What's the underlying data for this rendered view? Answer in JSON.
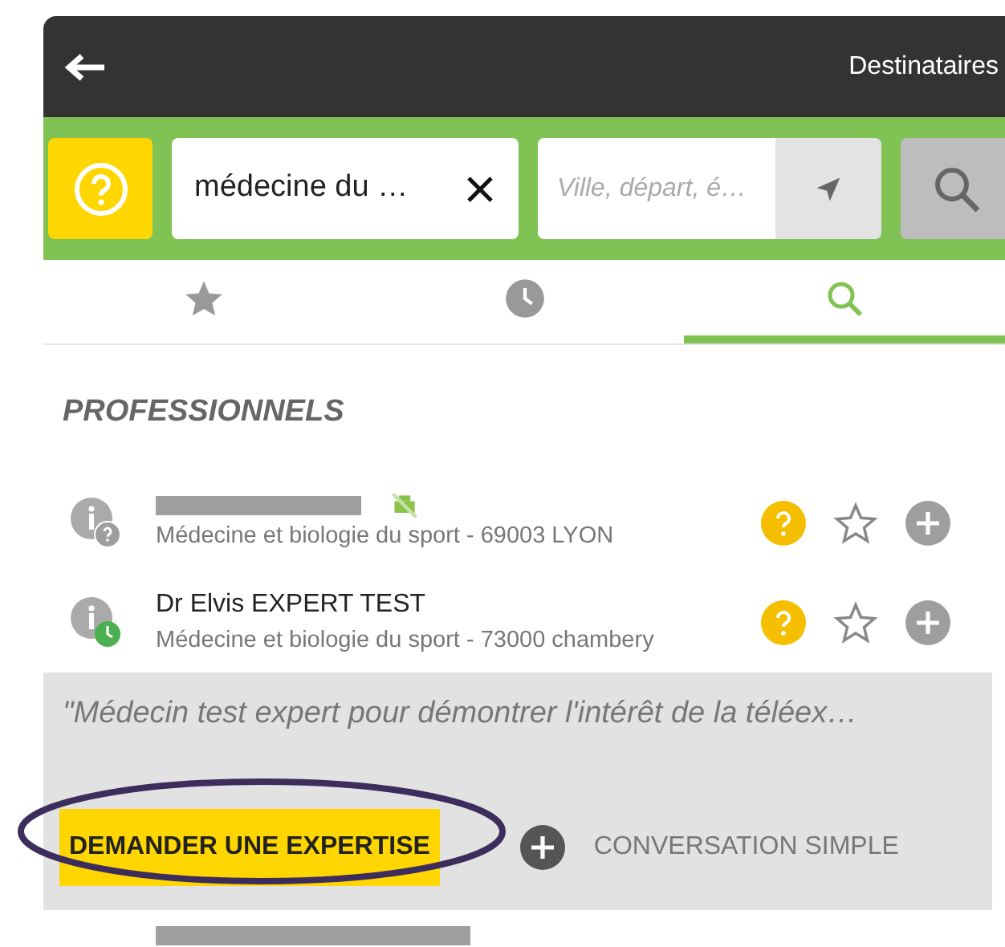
{
  "header": {
    "title": "Destinataires"
  },
  "search": {
    "query": "médecine du …",
    "location_placeholder": "Ville, départ, é…"
  },
  "tabs": [
    {
      "kind": "favorites",
      "selected": false
    },
    {
      "kind": "recent",
      "selected": false
    },
    {
      "kind": "search",
      "selected": true
    }
  ],
  "section_title": "PROFESSIONNELS",
  "professionals": [
    {
      "redacted": true,
      "kind": "unknown",
      "fax_disabled": true,
      "specialty": "Médecine et biologie du sport - 69003 LYON"
    },
    {
      "name": "Dr Elvis EXPERT TEST",
      "redacted": false,
      "kind": "available",
      "fax_disabled": false,
      "specialty": "Médecine et biologie du sport - 73000 chambery"
    }
  ],
  "details": {
    "quote": "\"Médecin test expert pour démontrer l'intérêt de la téléex…",
    "primary_action": "DEMANDER UNE EXPERTISE",
    "secondary_action": "CONVERSATION SIMPLE"
  }
}
